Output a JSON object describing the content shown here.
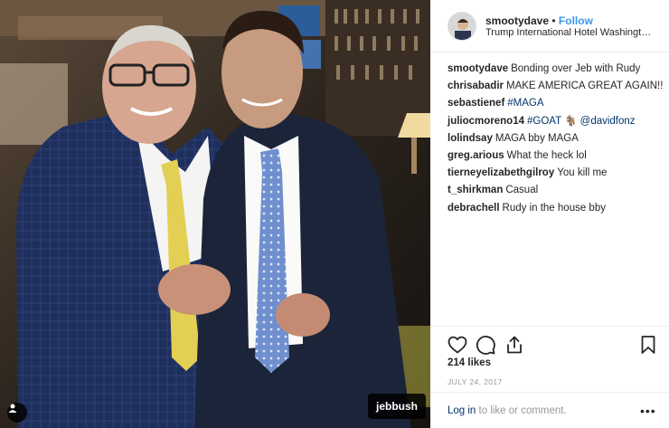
{
  "post": {
    "username": "smootydave",
    "separator": "•",
    "follow_label": "Follow",
    "location": "Trump International Hotel Washington, D.C."
  },
  "comments": [
    {
      "user": "smootydave",
      "parts": [
        {
          "text": "Bonding over Jeb with Rudy"
        }
      ]
    },
    {
      "user": "chrisabadir",
      "parts": [
        {
          "text": "MAKE AMERICA GREAT AGAIN!!"
        }
      ]
    },
    {
      "user": "sebastienef",
      "parts": [
        {
          "text": "#MAGA",
          "link": true
        }
      ]
    },
    {
      "user": "juliocmoreno14",
      "parts": [
        {
          "text": "#GOAT",
          "link": true
        },
        {
          "text": " 🐐 "
        },
        {
          "text": "@davidfonz",
          "link": true
        }
      ]
    },
    {
      "user": "lolindsay",
      "parts": [
        {
          "text": "MAGA bby MAGA"
        }
      ]
    },
    {
      "user": "greg.arious",
      "parts": [
        {
          "text": "What the heck lol"
        }
      ]
    },
    {
      "user": "tierneyelizabethgilroy",
      "parts": [
        {
          "text": "You kill me"
        }
      ]
    },
    {
      "user": "t_shirkman",
      "parts": [
        {
          "text": "Casual"
        }
      ]
    },
    {
      "user": "debrachell",
      "parts": [
        {
          "text": "Rudy in the house bby"
        }
      ]
    }
  ],
  "stats": {
    "likes": "214 likes",
    "date": "JULY 24, 2017"
  },
  "footer": {
    "login_link": "Log in",
    "login_suffix": " to like or comment.",
    "more": "•••"
  },
  "photo": {
    "tag_label": "jebbush"
  },
  "colors": {
    "follow": "#3897f0",
    "link": "#003569",
    "muted": "#999999",
    "text": "#262626"
  },
  "icons": {
    "like": "heart-outline-icon",
    "comment": "speech-bubble-icon",
    "share": "share-arrow-icon",
    "save": "bookmark-icon",
    "tagged_user": "person-icon"
  }
}
